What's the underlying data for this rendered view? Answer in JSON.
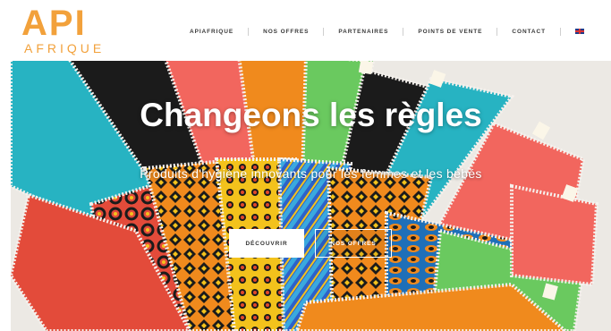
{
  "logo": {
    "main": "API",
    "sub": "AFRIQUE"
  },
  "nav": {
    "items": [
      "APIAFRIQUE",
      "NOS OFFRES",
      "PARTENAIRES",
      "POINTS DE VENTE",
      "CONTACT"
    ],
    "language_icon": "uk-flag-icon"
  },
  "hero": {
    "title": "Changeons les règles",
    "subtitle": "Produits d'hygiène innovants pour les femmes et les bébés",
    "primary_button": "DÉCOUVRIR",
    "secondary_button": "NOS OFFRES",
    "image_description_icon": "cloth-pads-fan-image"
  },
  "colors": {
    "brand": "#f2a13b",
    "nav_text": "#3a3a3a",
    "teal": "#27b3c2",
    "black": "#1b1b1b",
    "coral": "#f2665e",
    "green": "#6ac95f",
    "orange": "#f08a1d",
    "blue": "#3aa9de",
    "yellow": "#f3c21c"
  }
}
